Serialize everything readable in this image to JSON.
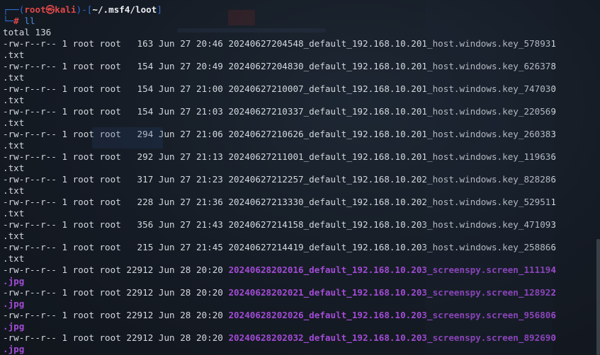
{
  "prompt": {
    "box_top": "┌──(",
    "user": "root㉿kali",
    "mid": ")-[",
    "path": "~/.msf4/loot",
    "end": "]",
    "box_bottom": "└─",
    "hash": "#",
    "command": "ll"
  },
  "total_line": "total 136",
  "entries": [
    {
      "meta": "-rw-r--r-- 1 root root   163 Jun 27 20:46 ",
      "name": "20240627204548_default_192.168.10.201_host.windows.key_578931",
      "wrap": ".txt",
      "type": "txt"
    },
    {
      "meta": "-rw-r--r-- 1 root root   154 Jun 27 20:49 ",
      "name": "20240627204830_default_192.168.10.201_host.windows.key_626378",
      "wrap": ".txt",
      "type": "txt"
    },
    {
      "meta": "-rw-r--r-- 1 root root   154 Jun 27 21:00 ",
      "name": "20240627210007_default_192.168.10.201_host.windows.key_747030",
      "wrap": ".txt",
      "type": "txt"
    },
    {
      "meta": "-rw-r--r-- 1 root root   154 Jun 27 21:03 ",
      "name": "20240627210337_default_192.168.10.201_host.windows.key_220569",
      "wrap": ".txt",
      "type": "txt"
    },
    {
      "meta": "-rw-r--r-- 1 root root   294 Jun 27 21:06 ",
      "name": "20240627210626_default_192.168.10.201_host.windows.key_260383",
      "wrap": ".txt",
      "type": "txt"
    },
    {
      "meta": "-rw-r--r-- 1 root root   292 Jun 27 21:13 ",
      "name": "20240627211001_default_192.168.10.201_host.windows.key_119636",
      "wrap": ".txt",
      "type": "txt"
    },
    {
      "meta": "-rw-r--r-- 1 root root   317 Jun 27 21:23 ",
      "name": "20240627212257_default_192.168.10.202_host.windows.key_828286",
      "wrap": ".txt",
      "type": "txt"
    },
    {
      "meta": "-rw-r--r-- 1 root root   228 Jun 27 21:36 ",
      "name": "20240627213330_default_192.168.10.202_host.windows.key_529511",
      "wrap": ".txt",
      "type": "txt"
    },
    {
      "meta": "-rw-r--r-- 1 root root   356 Jun 27 21:43 ",
      "name": "20240627214158_default_192.168.10.203_host.windows.key_471093",
      "wrap": ".txt",
      "type": "txt"
    },
    {
      "meta": "-rw-r--r-- 1 root root   215 Jun 27 21:45 ",
      "name": "20240627214419_default_192.168.10.203_host.windows.key_258866",
      "wrap": ".txt",
      "type": "txt"
    },
    {
      "meta": "-rw-r--r-- 1 root root 22912 Jun 28 20:20 ",
      "name": "20240628202016_default_192.168.10.203_screenspy.screen_111194",
      "wrap": ".jpg",
      "type": "jpg"
    },
    {
      "meta": "-rw-r--r-- 1 root root 22912 Jun 28 20:20 ",
      "name": "20240628202021_default_192.168.10.203_screenspy.screen_128922",
      "wrap": ".jpg",
      "type": "jpg"
    },
    {
      "meta": "-rw-r--r-- 1 root root 22912 Jun 28 20:20 ",
      "name": "20240628202026_default_192.168.10.203_screenspy.screen_956806",
      "wrap": ".jpg",
      "type": "jpg"
    },
    {
      "meta": "-rw-r--r-- 1 root root 22912 Jun 28 20:20 ",
      "name": "20240628202032_default_192.168.10.203_screenspy.screen_892690",
      "wrap": ".jpg",
      "type": "jpg"
    }
  ],
  "colors": {
    "background": "#151b24",
    "text": "#d4d8de",
    "prompt_box": "#2e6fd6",
    "prompt_user": "#e04848",
    "image_file": "#a24bd6",
    "command": "#4d8fe0"
  }
}
